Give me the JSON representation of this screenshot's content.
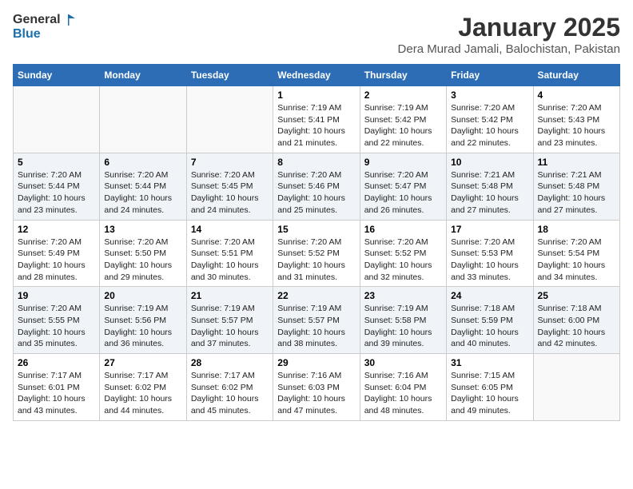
{
  "logo": {
    "line1": "General",
    "line2": "Blue"
  },
  "title": "January 2025",
  "subtitle": "Dera Murad Jamali, Balochistan, Pakistan",
  "weekdays": [
    "Sunday",
    "Monday",
    "Tuesday",
    "Wednesday",
    "Thursday",
    "Friday",
    "Saturday"
  ],
  "weeks": [
    [
      {
        "day": "",
        "info": ""
      },
      {
        "day": "",
        "info": ""
      },
      {
        "day": "",
        "info": ""
      },
      {
        "day": "1",
        "info": "Sunrise: 7:19 AM\nSunset: 5:41 PM\nDaylight: 10 hours\nand 21 minutes."
      },
      {
        "day": "2",
        "info": "Sunrise: 7:19 AM\nSunset: 5:42 PM\nDaylight: 10 hours\nand 22 minutes."
      },
      {
        "day": "3",
        "info": "Sunrise: 7:20 AM\nSunset: 5:42 PM\nDaylight: 10 hours\nand 22 minutes."
      },
      {
        "day": "4",
        "info": "Sunrise: 7:20 AM\nSunset: 5:43 PM\nDaylight: 10 hours\nand 23 minutes."
      }
    ],
    [
      {
        "day": "5",
        "info": "Sunrise: 7:20 AM\nSunset: 5:44 PM\nDaylight: 10 hours\nand 23 minutes."
      },
      {
        "day": "6",
        "info": "Sunrise: 7:20 AM\nSunset: 5:44 PM\nDaylight: 10 hours\nand 24 minutes."
      },
      {
        "day": "7",
        "info": "Sunrise: 7:20 AM\nSunset: 5:45 PM\nDaylight: 10 hours\nand 24 minutes."
      },
      {
        "day": "8",
        "info": "Sunrise: 7:20 AM\nSunset: 5:46 PM\nDaylight: 10 hours\nand 25 minutes."
      },
      {
        "day": "9",
        "info": "Sunrise: 7:20 AM\nSunset: 5:47 PM\nDaylight: 10 hours\nand 26 minutes."
      },
      {
        "day": "10",
        "info": "Sunrise: 7:21 AM\nSunset: 5:48 PM\nDaylight: 10 hours\nand 27 minutes."
      },
      {
        "day": "11",
        "info": "Sunrise: 7:21 AM\nSunset: 5:48 PM\nDaylight: 10 hours\nand 27 minutes."
      }
    ],
    [
      {
        "day": "12",
        "info": "Sunrise: 7:20 AM\nSunset: 5:49 PM\nDaylight: 10 hours\nand 28 minutes."
      },
      {
        "day": "13",
        "info": "Sunrise: 7:20 AM\nSunset: 5:50 PM\nDaylight: 10 hours\nand 29 minutes."
      },
      {
        "day": "14",
        "info": "Sunrise: 7:20 AM\nSunset: 5:51 PM\nDaylight: 10 hours\nand 30 minutes."
      },
      {
        "day": "15",
        "info": "Sunrise: 7:20 AM\nSunset: 5:52 PM\nDaylight: 10 hours\nand 31 minutes."
      },
      {
        "day": "16",
        "info": "Sunrise: 7:20 AM\nSunset: 5:52 PM\nDaylight: 10 hours\nand 32 minutes."
      },
      {
        "day": "17",
        "info": "Sunrise: 7:20 AM\nSunset: 5:53 PM\nDaylight: 10 hours\nand 33 minutes."
      },
      {
        "day": "18",
        "info": "Sunrise: 7:20 AM\nSunset: 5:54 PM\nDaylight: 10 hours\nand 34 minutes."
      }
    ],
    [
      {
        "day": "19",
        "info": "Sunrise: 7:20 AM\nSunset: 5:55 PM\nDaylight: 10 hours\nand 35 minutes."
      },
      {
        "day": "20",
        "info": "Sunrise: 7:19 AM\nSunset: 5:56 PM\nDaylight: 10 hours\nand 36 minutes."
      },
      {
        "day": "21",
        "info": "Sunrise: 7:19 AM\nSunset: 5:57 PM\nDaylight: 10 hours\nand 37 minutes."
      },
      {
        "day": "22",
        "info": "Sunrise: 7:19 AM\nSunset: 5:57 PM\nDaylight: 10 hours\nand 38 minutes."
      },
      {
        "day": "23",
        "info": "Sunrise: 7:19 AM\nSunset: 5:58 PM\nDaylight: 10 hours\nand 39 minutes."
      },
      {
        "day": "24",
        "info": "Sunrise: 7:18 AM\nSunset: 5:59 PM\nDaylight: 10 hours\nand 40 minutes."
      },
      {
        "day": "25",
        "info": "Sunrise: 7:18 AM\nSunset: 6:00 PM\nDaylight: 10 hours\nand 42 minutes."
      }
    ],
    [
      {
        "day": "26",
        "info": "Sunrise: 7:17 AM\nSunset: 6:01 PM\nDaylight: 10 hours\nand 43 minutes."
      },
      {
        "day": "27",
        "info": "Sunrise: 7:17 AM\nSunset: 6:02 PM\nDaylight: 10 hours\nand 44 minutes."
      },
      {
        "day": "28",
        "info": "Sunrise: 7:17 AM\nSunset: 6:02 PM\nDaylight: 10 hours\nand 45 minutes."
      },
      {
        "day": "29",
        "info": "Sunrise: 7:16 AM\nSunset: 6:03 PM\nDaylight: 10 hours\nand 47 minutes."
      },
      {
        "day": "30",
        "info": "Sunrise: 7:16 AM\nSunset: 6:04 PM\nDaylight: 10 hours\nand 48 minutes."
      },
      {
        "day": "31",
        "info": "Sunrise: 7:15 AM\nSunset: 6:05 PM\nDaylight: 10 hours\nand 49 minutes."
      },
      {
        "day": "",
        "info": ""
      }
    ]
  ]
}
